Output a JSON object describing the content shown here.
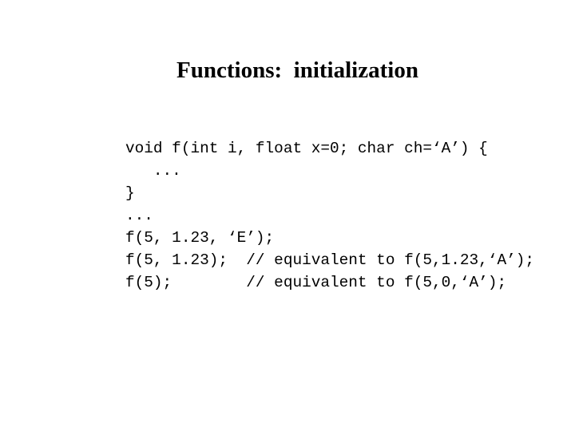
{
  "slide": {
    "title": "Functions:  initialization",
    "code_lines": [
      "void f(int i, float x=0; char ch=‘A’) {",
      "   ...",
      "}",
      "...",
      "f(5, 1.23, ‘E’);",
      "f(5, 1.23);  // equivalent to f(5,1.23,‘A’);",
      "f(5);        // equivalent to f(5,0,‘A’);"
    ]
  }
}
